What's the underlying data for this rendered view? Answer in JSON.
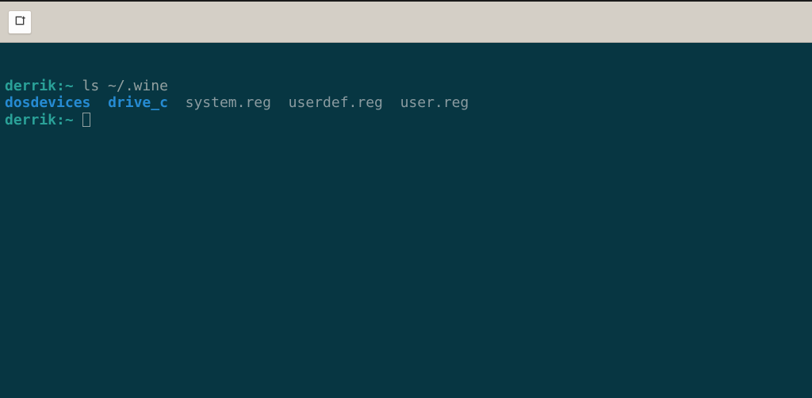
{
  "titlebar": {
    "new_tab_icon": "new-tab-icon"
  },
  "terminal": {
    "line1": {
      "prompt": "derrik:~",
      "command": " ls ~/.wine"
    },
    "line2": {
      "item1": "dosdevices",
      "gap1": "  ",
      "item2": "drive_c",
      "gap2": "  ",
      "item3": "system.reg",
      "gap3": "  ",
      "item4": "userdef.reg",
      "gap4": "  ",
      "item5": "user.reg"
    },
    "line3": {
      "prompt": "derrik:~",
      "space": " "
    }
  }
}
